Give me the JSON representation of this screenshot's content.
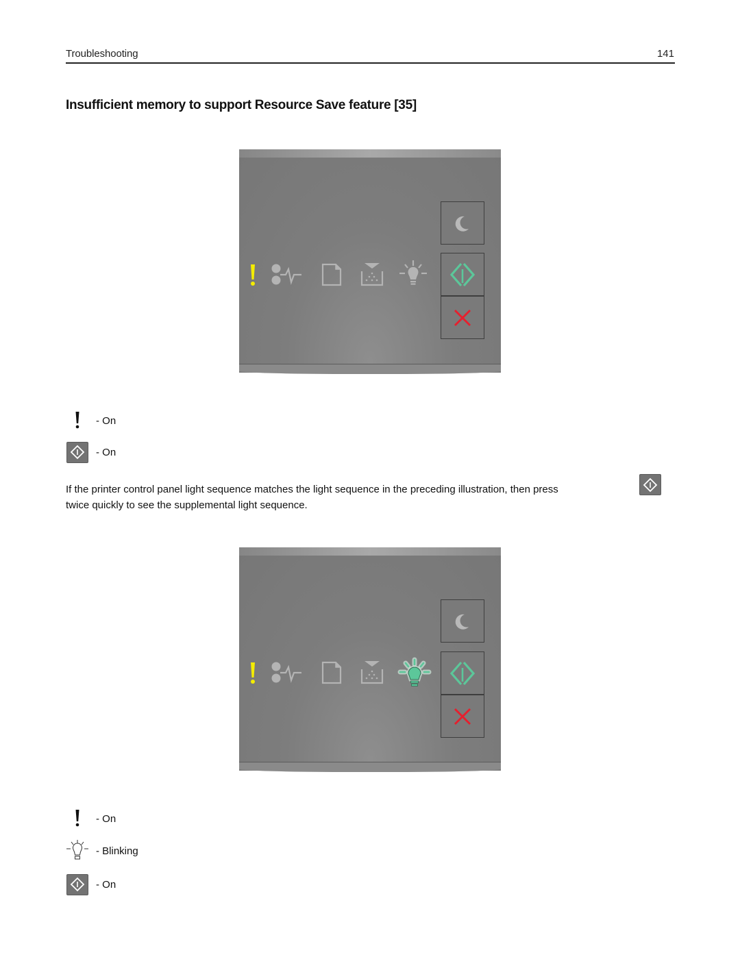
{
  "header": {
    "section": "Troubleshooting",
    "page_number": "141"
  },
  "title": "Insufficient memory to support Resource Save feature [35]",
  "colors": {
    "attention_yellow": "#f4ec00",
    "start_green": "#5cc79a",
    "cancel_red": "#e5202e",
    "inactive_icon": "#b4b4b4",
    "panel_gray": "#7b7b7b"
  },
  "panel1": {
    "lights": [
      {
        "name": "error-exclamation",
        "icon": "exclamation-icon",
        "state": "on"
      },
      {
        "name": "ready-data",
        "icon": "ready-data-icon",
        "state": "off"
      },
      {
        "name": "paper",
        "icon": "paper-icon",
        "state": "off"
      },
      {
        "name": "toner",
        "icon": "toner-icon",
        "state": "off"
      },
      {
        "name": "imaging-unit",
        "icon": "lightbulb-icon",
        "state": "off"
      }
    ],
    "buttons": [
      {
        "name": "sleep",
        "icon": "moon-icon"
      },
      {
        "name": "start",
        "icon": "start-diamond-icon",
        "state": "on"
      },
      {
        "name": "cancel",
        "icon": "x-icon"
      }
    ]
  },
  "legend1": [
    {
      "icon": "exclamation-icon",
      "label": "- On"
    },
    {
      "icon": "start-button-icon",
      "label": "- On"
    }
  ],
  "instruction": {
    "line1": "If the printer control panel light sequence matches the light sequence in the preceding illustration, then press",
    "line2": "twice quickly to see the supplemental light sequence."
  },
  "panel2": {
    "lights": [
      {
        "name": "error-exclamation",
        "icon": "exclamation-icon",
        "state": "on"
      },
      {
        "name": "ready-data",
        "icon": "ready-data-icon",
        "state": "off"
      },
      {
        "name": "paper",
        "icon": "paper-icon",
        "state": "off"
      },
      {
        "name": "toner",
        "icon": "toner-icon",
        "state": "off"
      },
      {
        "name": "imaging-unit",
        "icon": "lightbulb-icon",
        "state": "blinking"
      }
    ],
    "buttons": [
      {
        "name": "sleep",
        "icon": "moon-icon"
      },
      {
        "name": "start",
        "icon": "start-diamond-icon",
        "state": "on"
      },
      {
        "name": "cancel",
        "icon": "x-icon"
      }
    ]
  },
  "legend2": [
    {
      "icon": "exclamation-icon",
      "label": "- On"
    },
    {
      "icon": "lightbulb-icon",
      "label": "- Blinking"
    },
    {
      "icon": "start-button-icon",
      "label": "- On"
    }
  ]
}
